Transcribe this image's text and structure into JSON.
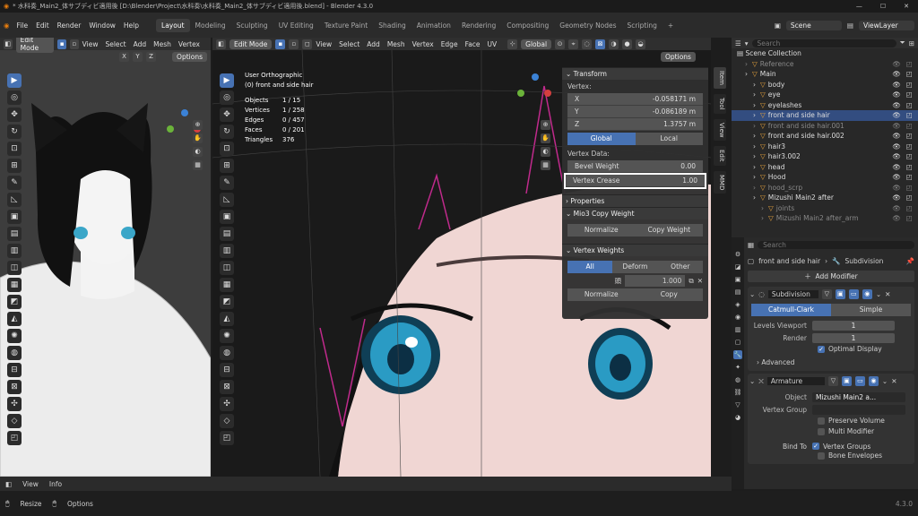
{
  "titlebar": {
    "text": "* 水科奏_Main2_体サブディビ適用後 [D:\\Blender\\Project\\水科奏\\水科奏_Main2_体サブディビ適用後.blend] - Blender 4.3.0"
  },
  "menubar": {
    "items": [
      "File",
      "Edit",
      "Render",
      "Window",
      "Help"
    ],
    "workspaces": [
      "Layout",
      "Modeling",
      "Sculpting",
      "UV Editing",
      "Texture Paint",
      "Shading",
      "Animation",
      "Rendering",
      "Compositing",
      "Geometry Nodes",
      "Scripting",
      "+"
    ],
    "active_workspace": "Layout",
    "scene": "Scene",
    "viewlayer": "ViewLayer"
  },
  "left_viewport": {
    "mode": "Edit Mode",
    "menus": [
      "View",
      "Select",
      "Add",
      "Mesh",
      "Vertex"
    ],
    "axes": [
      "X",
      "Y",
      "Z"
    ],
    "options": "Options"
  },
  "main_viewport": {
    "mode": "Edit Mode",
    "menus": [
      "View",
      "Select",
      "Add",
      "Mesh",
      "Vertex",
      "Edge",
      "Face",
      "UV"
    ],
    "orientation": "Global",
    "options": "Options",
    "view_name": "User Orthographic",
    "object_label": "(0) front and side hair",
    "stats": [
      {
        "label": "Objects",
        "value": "1 / 15"
      },
      {
        "label": "Vertices",
        "value": "1 / 258"
      },
      {
        "label": "Edges",
        "value": "0 / 457"
      },
      {
        "label": "Faces",
        "value": "0 / 201"
      },
      {
        "label": "Triangles",
        "value": "376"
      }
    ]
  },
  "npanel": {
    "tabs": [
      "Item",
      "Tool",
      "View",
      "Edit",
      "MMD"
    ],
    "transform": {
      "title": "Transform",
      "vertex_label": "Vertex:",
      "x_label": "X",
      "x": "-0.058171 m",
      "y_label": "Y",
      "y": "-0.086189 m",
      "z_label": "Z",
      "z": "1.3757 m",
      "global": "Global",
      "local": "Local",
      "vertex_data": "Vertex Data:",
      "bevel_label": "Bevel Weight",
      "bevel": "0.00",
      "crease_label": "Vertex Crease",
      "crease": "1.00"
    },
    "properties": {
      "title": "Properties"
    },
    "mio3": {
      "title": "Mio3 Copy Weight",
      "normalize": "Normalize",
      "copy": "Copy Weight"
    },
    "vgroups": {
      "title": "Vertex Weights",
      "all": "All",
      "deform": "Deform",
      "other": "Other",
      "weight_name": "頭",
      "weight_value": "1.000",
      "normalize": "Normalize",
      "copy": "Copy"
    }
  },
  "outliner": {
    "search": "Search",
    "collection": "Scene Collection",
    "rows": [
      {
        "name": "Reference",
        "indent": 1,
        "dim": true
      },
      {
        "name": "Main",
        "indent": 1
      },
      {
        "name": "body",
        "indent": 2
      },
      {
        "name": "eye",
        "indent": 2
      },
      {
        "name": "eyelashes",
        "indent": 2
      },
      {
        "name": "front and side hair",
        "indent": 2,
        "sel": true
      },
      {
        "name": "front and side hair.001",
        "indent": 2,
        "dim": true
      },
      {
        "name": "front and side hair.002",
        "indent": 2
      },
      {
        "name": "hair3",
        "indent": 2
      },
      {
        "name": "hair3.002",
        "indent": 2
      },
      {
        "name": "head",
        "indent": 2
      },
      {
        "name": "Hood",
        "indent": 2
      },
      {
        "name": "hood_scrp",
        "indent": 2,
        "dim": true
      },
      {
        "name": "Mizushi Main2 after",
        "indent": 2
      },
      {
        "name": "joints",
        "indent": 3,
        "dim": true
      },
      {
        "name": "Mizushi Main2 after_arm",
        "indent": 3,
        "dim": true
      }
    ]
  },
  "properties": {
    "search": "Search",
    "breadcrumb_obj": "front and side hair",
    "breadcrumb_mod": "Subdivision",
    "add_modifier": "Add Modifier",
    "subdiv": {
      "name": "Subdivision",
      "catmull": "Catmull-Clark",
      "simple": "Simple",
      "levels_label": "Levels Viewport",
      "levels": "1",
      "render_label": "Render",
      "render": "1",
      "optimal": "Optimal Display",
      "advanced": "Advanced"
    },
    "armature": {
      "name": "Armature",
      "object_label": "Object",
      "object": "Mizushi Main2 a...",
      "vgroup_label": "Vertex Group",
      "preserve": "Preserve Volume",
      "multi": "Multi Modifier",
      "bind_label": "Bind To",
      "vgroups": "Vertex Groups",
      "envelopes": "Bone Envelopes"
    }
  },
  "bottom": {
    "view": "View",
    "info": "Info",
    "resize": "Resize",
    "options": "Options",
    "version": "4.3.0"
  }
}
